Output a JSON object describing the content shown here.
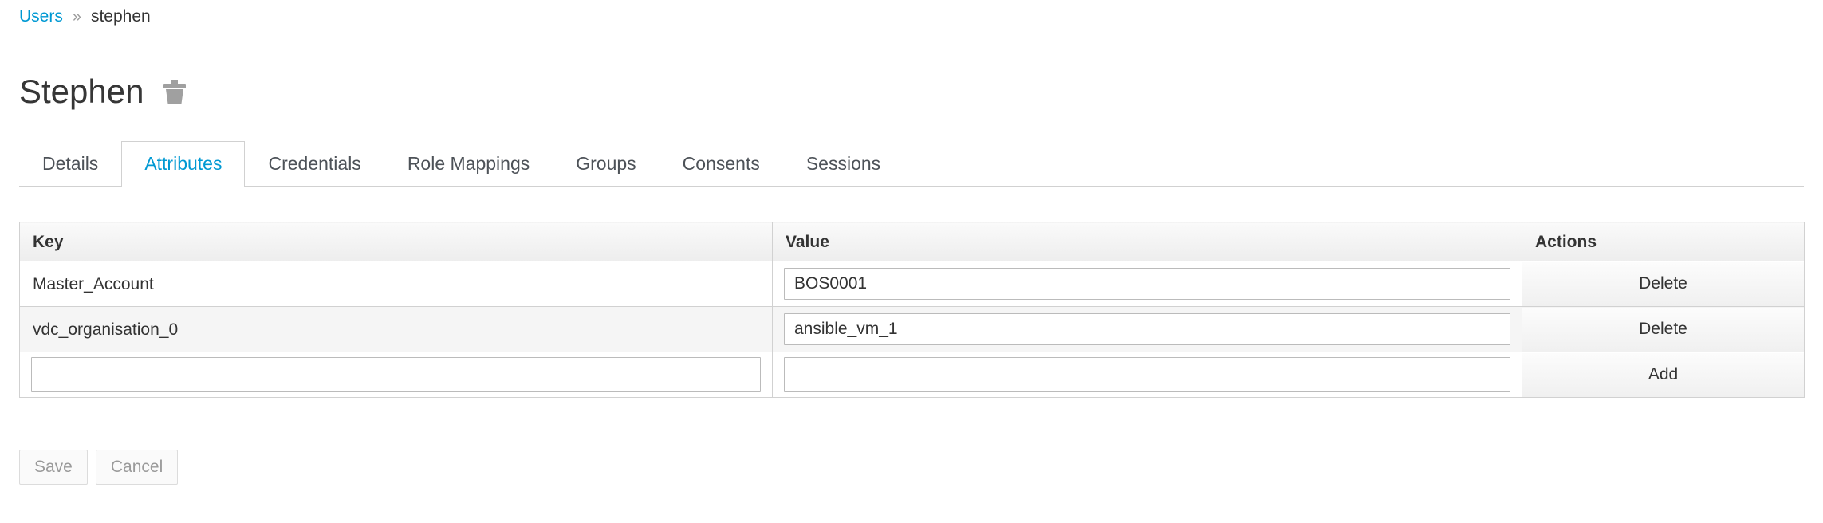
{
  "breadcrumb": {
    "parent_label": "Users",
    "separator": "»",
    "current_label": "stephen"
  },
  "header": {
    "title": "Stephen",
    "delete_icon": "trash-icon"
  },
  "tabs": [
    {
      "label": "Details",
      "active": false
    },
    {
      "label": "Attributes",
      "active": true
    },
    {
      "label": "Credentials",
      "active": false
    },
    {
      "label": "Role Mappings",
      "active": false
    },
    {
      "label": "Groups",
      "active": false
    },
    {
      "label": "Consents",
      "active": false
    },
    {
      "label": "Sessions",
      "active": false
    }
  ],
  "table": {
    "columns": [
      "Key",
      "Value",
      "Actions"
    ],
    "rows": [
      {
        "key": "Master_Account",
        "value": "BOS0001",
        "action": "Delete"
      },
      {
        "key": "vdc_organisation_0",
        "value": "ansible_vm_1",
        "action": "Delete"
      }
    ],
    "new_row": {
      "key": "",
      "value": "",
      "key_placeholder": "",
      "value_placeholder": "",
      "action": "Add"
    }
  },
  "footer": {
    "save_label": "Save",
    "cancel_label": "Cancel"
  },
  "colors": {
    "link": "#0099d3",
    "active_tab": "#0099d3",
    "text": "#333333",
    "border": "#d1d1d1",
    "stripe": "#f5f5f5"
  }
}
